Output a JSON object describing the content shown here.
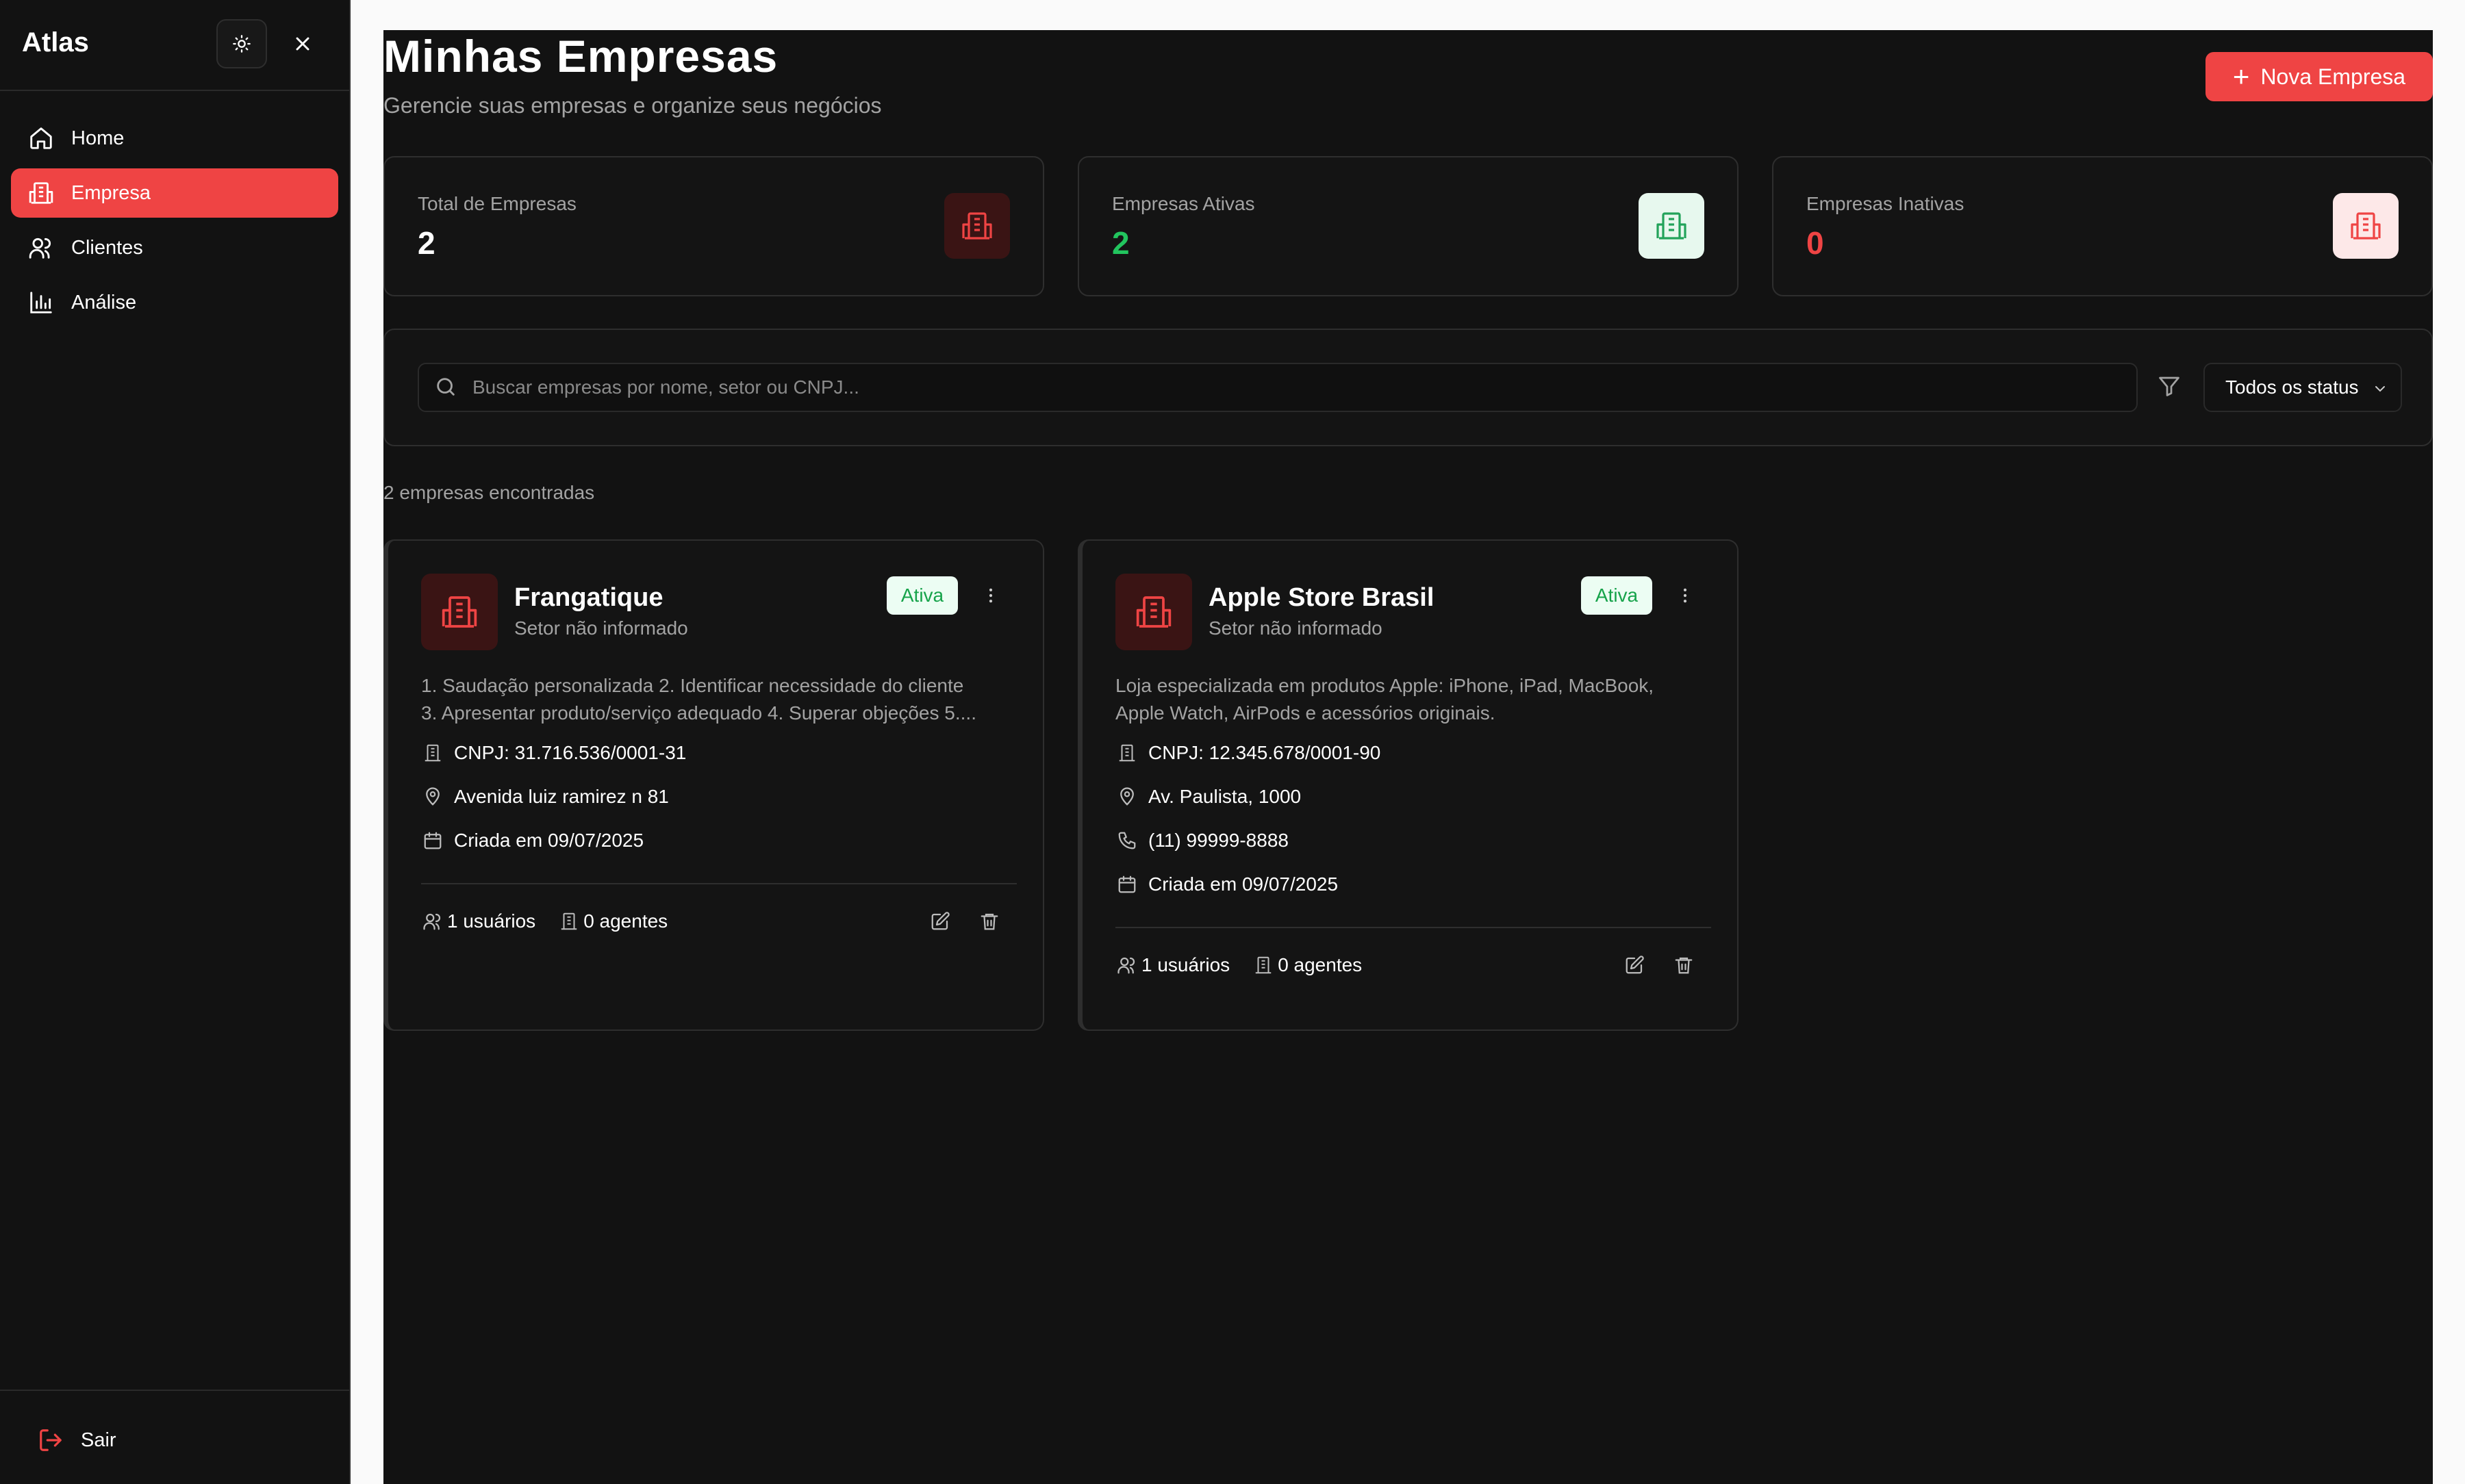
{
  "app": {
    "brand": "Atlas"
  },
  "sidebar": {
    "items": [
      {
        "label": "Home",
        "icon": "home-icon"
      },
      {
        "label": "Empresa",
        "icon": "building-icon",
        "active": true
      },
      {
        "label": "Clientes",
        "icon": "users-icon"
      },
      {
        "label": "Análise",
        "icon": "bar-chart-icon"
      }
    ],
    "logout_label": "Sair"
  },
  "header": {
    "title": "Minhas Empresas",
    "subtitle": "Gerencie suas empresas e organize seus negócios",
    "new_button_label": "Nova Empresa"
  },
  "stats": [
    {
      "label": "Total de Empresas",
      "value": "2",
      "color": "#ffffff",
      "icon_bg": "#3a1414",
      "icon_color": "#ef4444"
    },
    {
      "label": "Empresas Ativas",
      "value": "2",
      "color": "#22c55e",
      "icon_bg": "#e7f8ee",
      "icon_color": "#22a35a"
    },
    {
      "label": "Empresas Inativas",
      "value": "0",
      "color": "#ef4444",
      "icon_bg": "#fde8e8",
      "icon_color": "#ef4444"
    }
  ],
  "filters": {
    "search_placeholder": "Buscar empresas por nome, setor ou CNPJ...",
    "search_value": "",
    "status_selected": "Todos os status"
  },
  "results_count": "2 empresas encontradas",
  "companies": [
    {
      "name": "Frangatique",
      "sector": "Setor não informado",
      "status": "Ativa",
      "description_lines": [
        "1. Saudação personalizada 2. Identificar necessidade do cliente",
        "3. Apresentar produto/serviço adequado 4. Superar objeções 5...."
      ],
      "cnpj": "CNPJ: 31.716.536/0001-31",
      "address": "Avenida luiz ramirez n 81",
      "phone": null,
      "created": "Criada em 09/07/2025",
      "users": "1 usuários",
      "agents": "0 agentes"
    },
    {
      "name": "Apple Store Brasil",
      "sector": "Setor não informado",
      "status": "Ativa",
      "description_lines": [
        "Loja especializada em produtos Apple: iPhone, iPad, MacBook,",
        "Apple Watch, AirPods e acessórios originais."
      ],
      "cnpj": "CNPJ: 12.345.678/0001-90",
      "address": "Av. Paulista, 1000",
      "phone": "(11) 99999-8888",
      "created": "Criada em 09/07/2025",
      "users": "1 usuários",
      "agents": "0 agentes"
    }
  ],
  "colors": {
    "accent": "#ef4444",
    "background": "#121212",
    "success": "#22c55e"
  }
}
